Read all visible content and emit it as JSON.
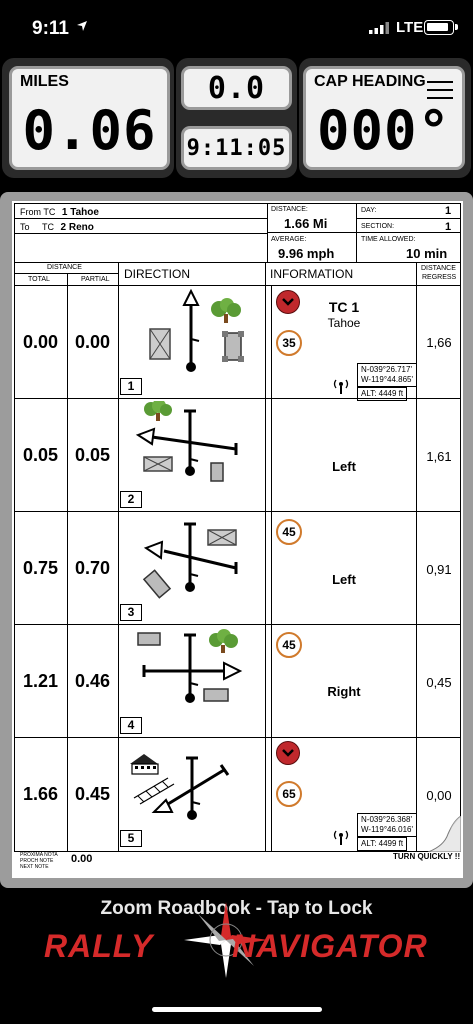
{
  "status": {
    "time": "9:11",
    "network": "LTE"
  },
  "odometer": {
    "miles_label": "MILES",
    "miles_value": "0.06",
    "center_top_value": "0.0",
    "center_bottom_value": "9:11:05",
    "cap_label": "CAP HEADING",
    "cap_value": "000°"
  },
  "sheet": {
    "from_prefix": "From TC",
    "from_value": "1 Tahoe",
    "to_prefix": "To",
    "to_tc": "TC",
    "to_value": "2 Reno",
    "distance_label": "DISTANCE:",
    "distance_value": "1.66 Mi",
    "day_label": "DAY:",
    "day_value": "1",
    "section_label": "SECTION:",
    "section_value": "1",
    "average_label": "AVERAGE:",
    "average_value": "9.96 mph",
    "time_allowed_label": "TIME ALLOWED:",
    "time_allowed_value": "10 min",
    "col_distance": "DISTANCE",
    "col_total": "TOTAL",
    "col_partial": "PARTIAL",
    "col_direction": "DIRECTION",
    "col_information": "INFORMATION",
    "col_regress_1": "DISTANCE",
    "col_regress_2": "REGRESS",
    "rows": [
      {
        "total": "0.00",
        "partial": "0.00",
        "num": "1",
        "regress": "1,66",
        "tc_title": "TC 1",
        "tc_sub": "Tahoe",
        "speed": "35",
        "gps1": "N-039°26.717'",
        "gps2": "W-119°44.865'",
        "alt": "ALT: 4449 ft"
      },
      {
        "total": "0.05",
        "partial": "0.05",
        "num": "2",
        "regress": "1,61",
        "info": "Left"
      },
      {
        "total": "0.75",
        "partial": "0.70",
        "num": "3",
        "regress": "0,91",
        "info": "Left",
        "speed": "45"
      },
      {
        "total": "1.21",
        "partial": "0.46",
        "num": "4",
        "regress": "0,45",
        "info": "Right",
        "speed": "45"
      },
      {
        "total": "1.66",
        "partial": "0.45",
        "num": "5",
        "regress": "0,00",
        "speed": "65",
        "gps1": "N-039°26.368'",
        "gps2": "W-119°46.016'",
        "alt": "ALT: 4499 ft"
      }
    ],
    "next_note_1": "PROXIMA NOTA",
    "next_note_2": "PROCH NOTE",
    "next_note_3": "NEXT NOTE",
    "next_note_value": "0.00",
    "turn_quickly": "TURN QUICKLY !!"
  },
  "footer": {
    "title": "Zoom Roadbook - Tap to Lock",
    "brand_left": "RALLY",
    "brand_right": "NAVIGATOR"
  },
  "colors": {
    "alert_red": "#c0282c",
    "speed_orange": "#d07a2c",
    "brand_red": "#d52a2a"
  }
}
